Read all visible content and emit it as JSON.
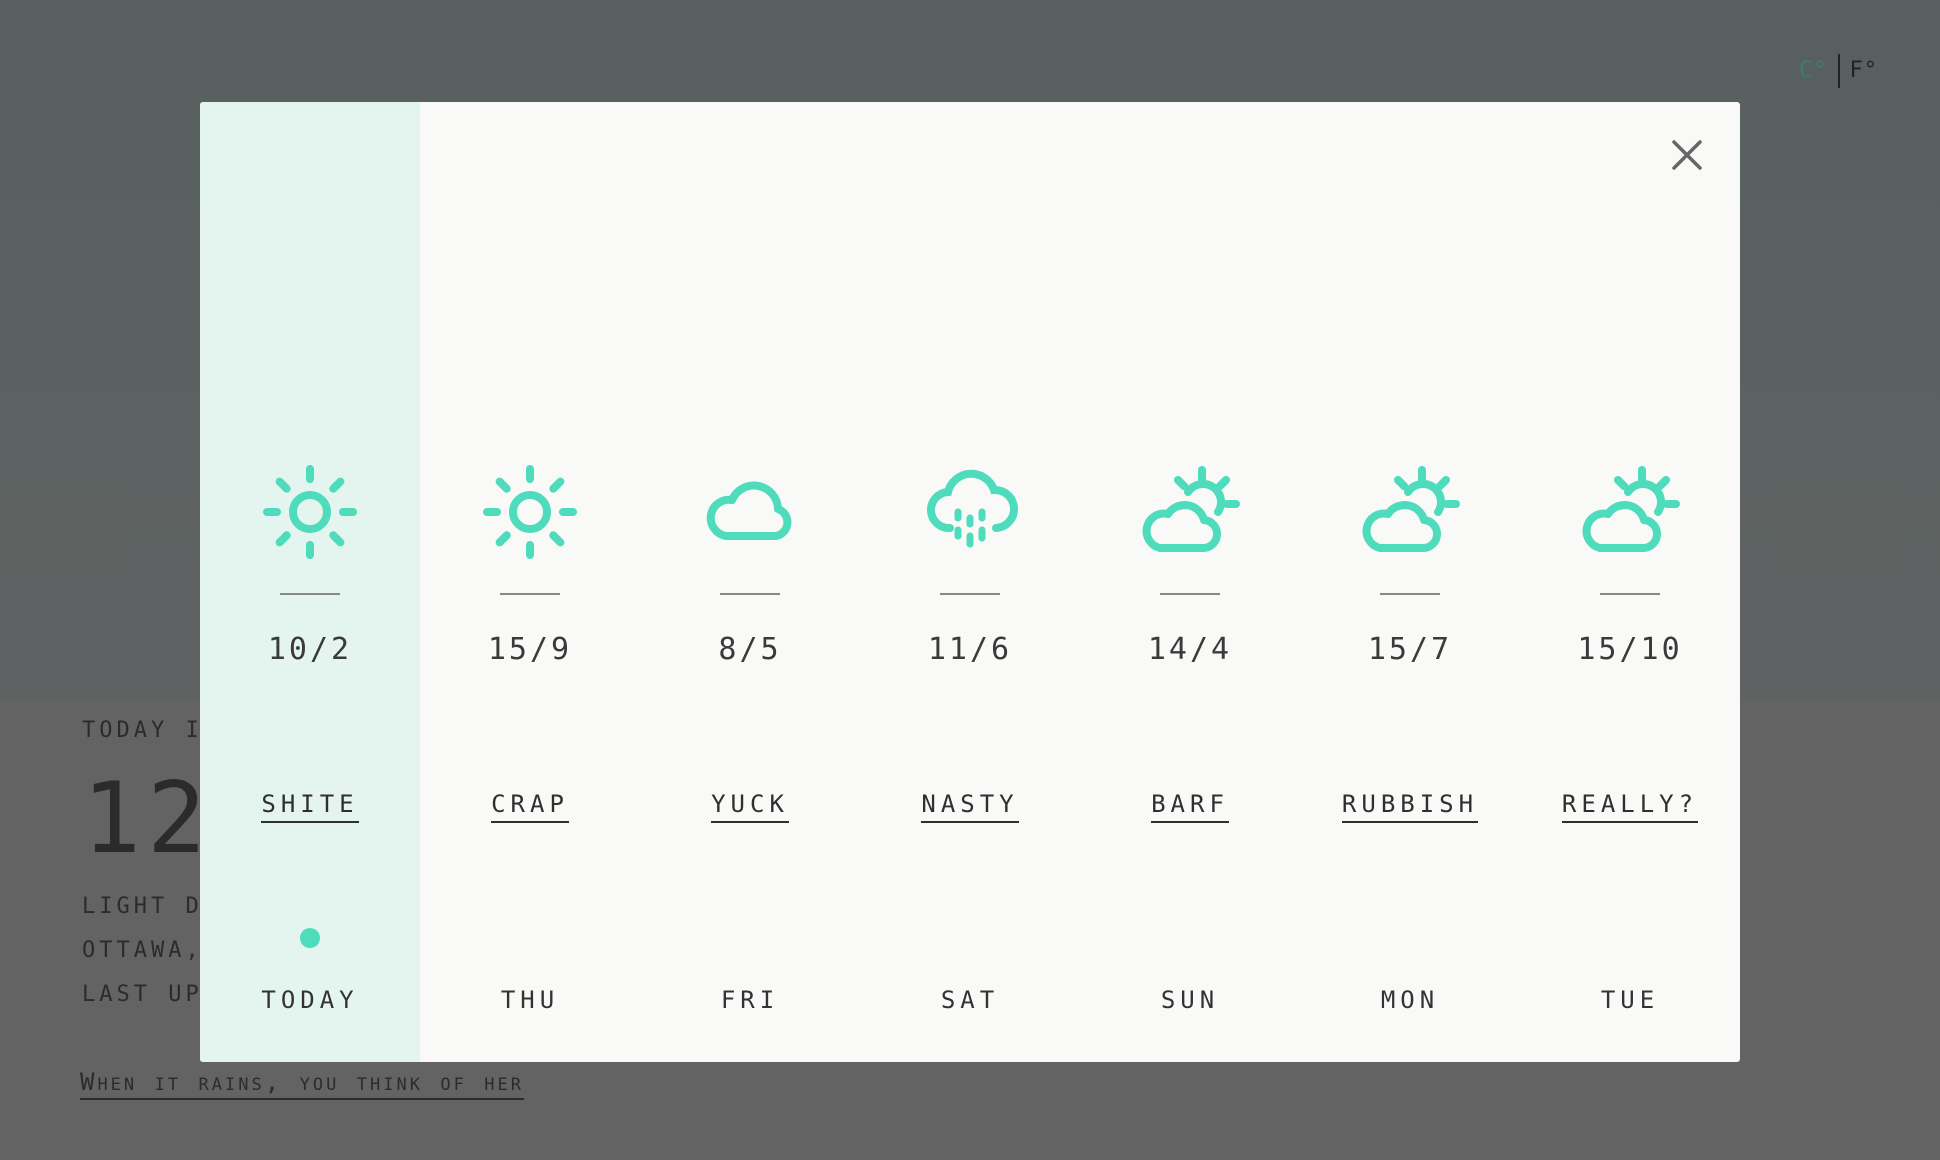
{
  "colors": {
    "accent": "#4fdcbc",
    "active_column": "#e4f5f0",
    "overlay": "#5c6160"
  },
  "units": {
    "celsius": "C°",
    "fahrenheit": "F°",
    "selected": "C°"
  },
  "background": {
    "today_label": "TODAY IS",
    "temp": "12",
    "line1": "LIGHT DR",
    "line2": "OTTAWA,",
    "line3": "LAST UPD",
    "quote": "When it rains, you think of her"
  },
  "modal": {
    "close_icon": "close-icon",
    "days": [
      {
        "icon": "sun",
        "temps": "10/2",
        "verdict": "SHITE",
        "day": "TODAY",
        "active": true
      },
      {
        "icon": "sun",
        "temps": "15/9",
        "verdict": "CRAP",
        "day": "THU",
        "active": false
      },
      {
        "icon": "cloud",
        "temps": "8/5",
        "verdict": "YUCK",
        "day": "FRI",
        "active": false
      },
      {
        "icon": "cloud-drizzle",
        "temps": "11/6",
        "verdict": "NASTY",
        "day": "SAT",
        "active": false
      },
      {
        "icon": "partly-cloudy",
        "temps": "14/4",
        "verdict": "BARF",
        "day": "SUN",
        "active": false
      },
      {
        "icon": "partly-cloudy",
        "temps": "15/7",
        "verdict": "RUBBISH",
        "day": "MON",
        "active": false
      },
      {
        "icon": "partly-cloudy",
        "temps": "15/10",
        "verdict": "REALLY?",
        "day": "TUE",
        "active": false
      }
    ]
  }
}
